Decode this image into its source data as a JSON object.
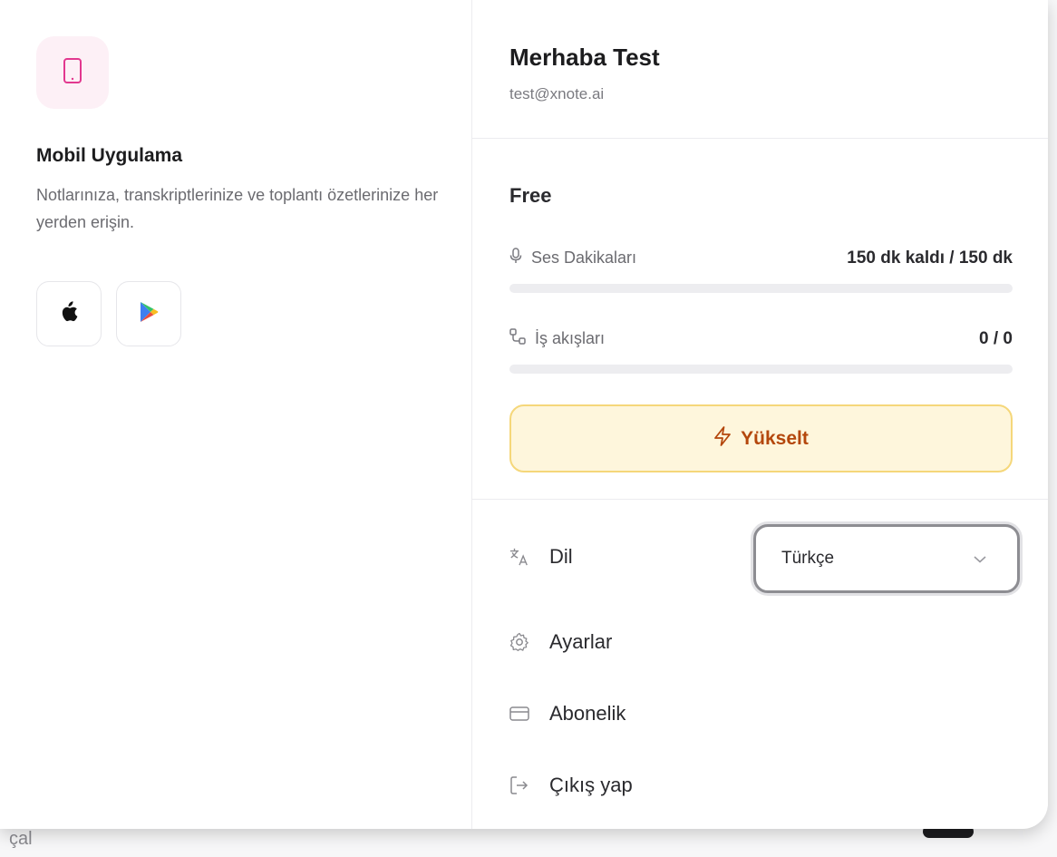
{
  "background": {
    "partial_text": "çal"
  },
  "mobile": {
    "icon": "tablet-icon",
    "title": "Mobil Uygulama",
    "description": "Notlarınıza, transkriptlerinize ve toplantı özetlerinize her yerden erişin.",
    "stores": [
      {
        "icon": "apple-icon"
      },
      {
        "icon": "google-play-icon"
      }
    ]
  },
  "user": {
    "name": "Merhaba Test",
    "email": "test@xnote.ai"
  },
  "plan": {
    "name": "Free",
    "usage": [
      {
        "icon": "microphone-icon",
        "label": "Ses Dakikaları",
        "value": "150 dk kaldı / 150 dk",
        "progress": 0
      },
      {
        "icon": "workflow-icon",
        "label": "İş akışları",
        "value": "0 / 0",
        "progress": 0
      }
    ],
    "upgrade_label": "Yükselt"
  },
  "menu": {
    "language": {
      "icon": "translate-icon",
      "label": "Dil",
      "selected": "Türkçe"
    },
    "settings": {
      "icon": "gear-icon",
      "label": "Ayarlar"
    },
    "subscription": {
      "icon": "credit-card-icon",
      "label": "Abonelik"
    },
    "logout": {
      "icon": "logout-icon",
      "label": "Çıkış yap"
    }
  },
  "colors": {
    "accent_pink": "#e2388f",
    "upgrade_bg": "#fef6dc",
    "upgrade_border": "#f5d77a",
    "upgrade_text": "#b4470c"
  }
}
